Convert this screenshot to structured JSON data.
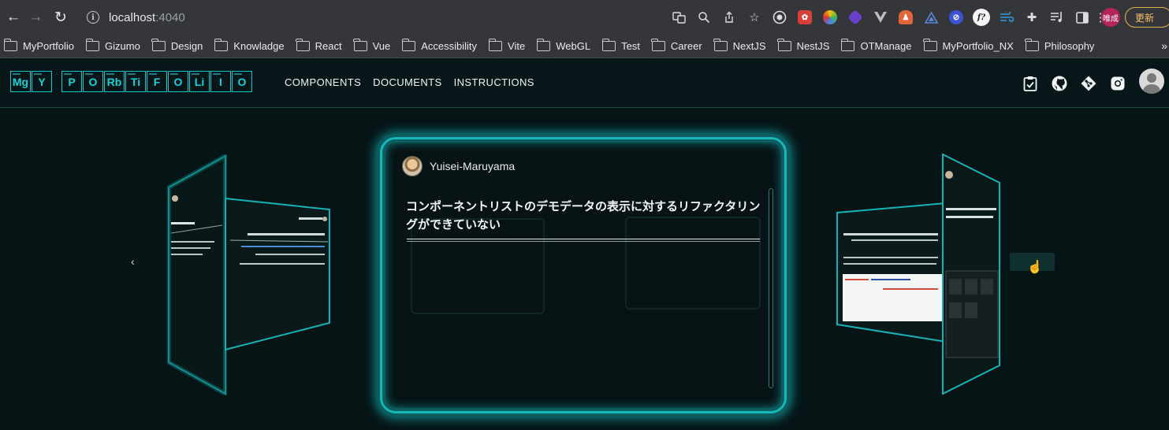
{
  "browser": {
    "url_host": "localhost",
    "url_port": ":4040",
    "profile_initials": "唯成",
    "update_label": "更新",
    "bookmarks": [
      "MyPortfolio",
      "Gizumo",
      "Design",
      "Knowladge",
      "React",
      "Vue",
      "Accessibility",
      "Vite",
      "WebGL",
      "Test",
      "Career",
      "NextJS",
      "NestJS",
      "OTManage",
      "MyPortfolio_NX",
      "Philosophy"
    ],
    "bookmarks_overflow": "»"
  },
  "header": {
    "logo_letters": [
      "Mg",
      "Y",
      "",
      "P",
      "O",
      "Rb",
      "Ti",
      "F",
      "O",
      "Li",
      "I",
      "O"
    ],
    "nav": [
      "COMPONENTS",
      "DOCUMENTS",
      "INSTRUCTIONS"
    ],
    "accent_color": "#18c7c9"
  },
  "carousel": {
    "prev_label": "‹",
    "next_label": "›",
    "main_card": {
      "username": "Yuisei-Maruyama",
      "title": "コンポーネントリストのデモデータの表示に対するリファクタリングができていない"
    }
  }
}
